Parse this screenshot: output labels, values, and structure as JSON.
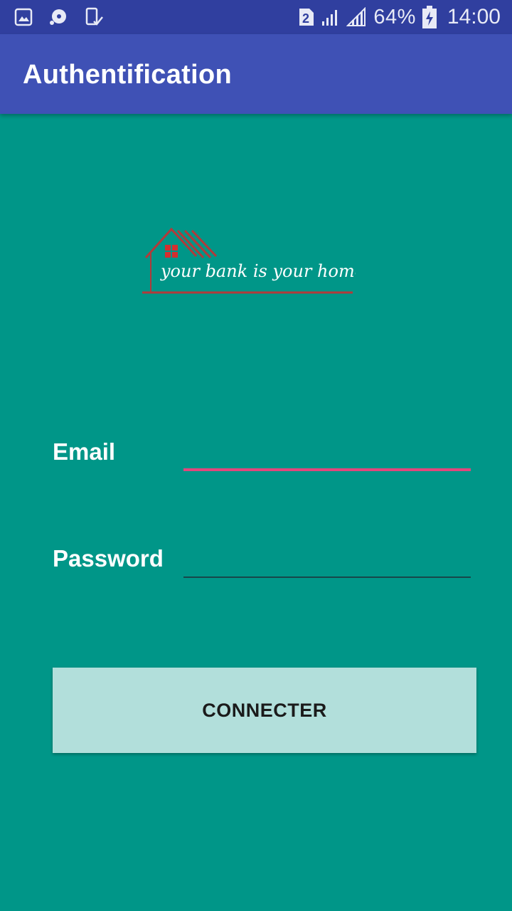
{
  "status_bar": {
    "sim_badge": "2",
    "battery_percent": "64%",
    "time": "14:00",
    "icons": [
      "image-icon",
      "disc-icon",
      "phone-check-icon",
      "sim-2-icon",
      "signal-icon",
      "signal-alt-icon",
      "battery-charging-icon"
    ]
  },
  "app_bar": {
    "title": "Authentification"
  },
  "logo": {
    "tagline": "your bank is your home",
    "colors": {
      "house": "#B23A3A",
      "window": "#D32F2F",
      "text": "#ffffff"
    }
  },
  "form": {
    "email_label": "Email",
    "email_value": "",
    "password_label": "Password",
    "password_value": "",
    "submit_label": "CONNECTER"
  },
  "colors": {
    "status_bar": "#303F9F",
    "app_bar": "#3F51B5",
    "background": "#009688",
    "email_underline": "#E2477D",
    "button_bg": "#B2DFDB"
  }
}
